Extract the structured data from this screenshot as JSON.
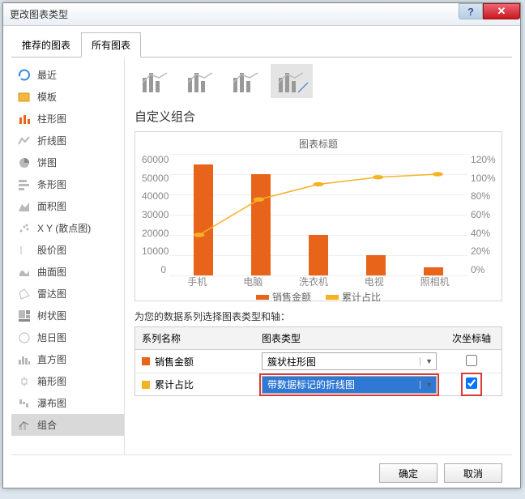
{
  "window": {
    "title": "更改图表类型"
  },
  "tabs": [
    {
      "label": "推荐的图表",
      "active": false
    },
    {
      "label": "所有图表",
      "active": true
    }
  ],
  "sidebar": {
    "items": [
      {
        "label": "最近",
        "icon": "recent-icon"
      },
      {
        "label": "模板",
        "icon": "template-icon"
      },
      {
        "label": "柱形图",
        "icon": "column-icon"
      },
      {
        "label": "折线图",
        "icon": "line-icon"
      },
      {
        "label": "饼图",
        "icon": "pie-icon"
      },
      {
        "label": "条形图",
        "icon": "bar-icon"
      },
      {
        "label": "面积图",
        "icon": "area-icon"
      },
      {
        "label": "X Y (散点图)",
        "icon": "scatter-icon"
      },
      {
        "label": "股价图",
        "icon": "stock-icon"
      },
      {
        "label": "曲面图",
        "icon": "surface-icon"
      },
      {
        "label": "雷达图",
        "icon": "radar-icon"
      },
      {
        "label": "树状图",
        "icon": "treemap-icon"
      },
      {
        "label": "旭日图",
        "icon": "sunburst-icon"
      },
      {
        "label": "直方图",
        "icon": "histogram-icon"
      },
      {
        "label": "箱形图",
        "icon": "box-icon"
      },
      {
        "label": "瀑布图",
        "icon": "waterfall-icon"
      },
      {
        "label": "组合",
        "icon": "combo-icon",
        "selected": true
      }
    ]
  },
  "section_title": "自定义组合",
  "thumbs": {
    "selected_index": 3,
    "count": 4
  },
  "chart_data": {
    "type": "combo",
    "title": "图表标题",
    "categories": [
      "手机",
      "电脑",
      "洗衣机",
      "电视",
      "照相机"
    ],
    "ylim": [
      0,
      60000
    ],
    "yticks": [
      0,
      10000,
      20000,
      30000,
      40000,
      50000,
      60000
    ],
    "y2lim": [
      0,
      1.2
    ],
    "y2ticks": [
      "0%",
      "20%",
      "40%",
      "60%",
      "80%",
      "100%",
      "120%"
    ],
    "series": [
      {
        "name": "销售金额",
        "type": "bar",
        "color": "#e8641b",
        "values": [
          55000,
          50000,
          20000,
          10000,
          4000
        ]
      },
      {
        "name": "累计占比",
        "type": "line",
        "color": "#f5b324",
        "axis": "secondary",
        "values": [
          0.4,
          0.75,
          0.9,
          0.97,
          1.0
        ]
      }
    ]
  },
  "table": {
    "caption": "为您的数据系列选择图表类型和轴：",
    "headers": {
      "c1": "系列名称",
      "c2": "图表类型",
      "c3": "次坐标轴"
    },
    "rows": [
      {
        "swatch": "#e8641b",
        "name": "销售金额",
        "chart_type": "簇状柱形图",
        "secondary": false,
        "highlighted": false
      },
      {
        "swatch": "#f5b324",
        "name": "累计占比",
        "chart_type": "带数据标记的折线图",
        "secondary": true,
        "highlighted": true
      }
    ]
  },
  "buttons": {
    "ok": "确定",
    "cancel": "取消"
  }
}
